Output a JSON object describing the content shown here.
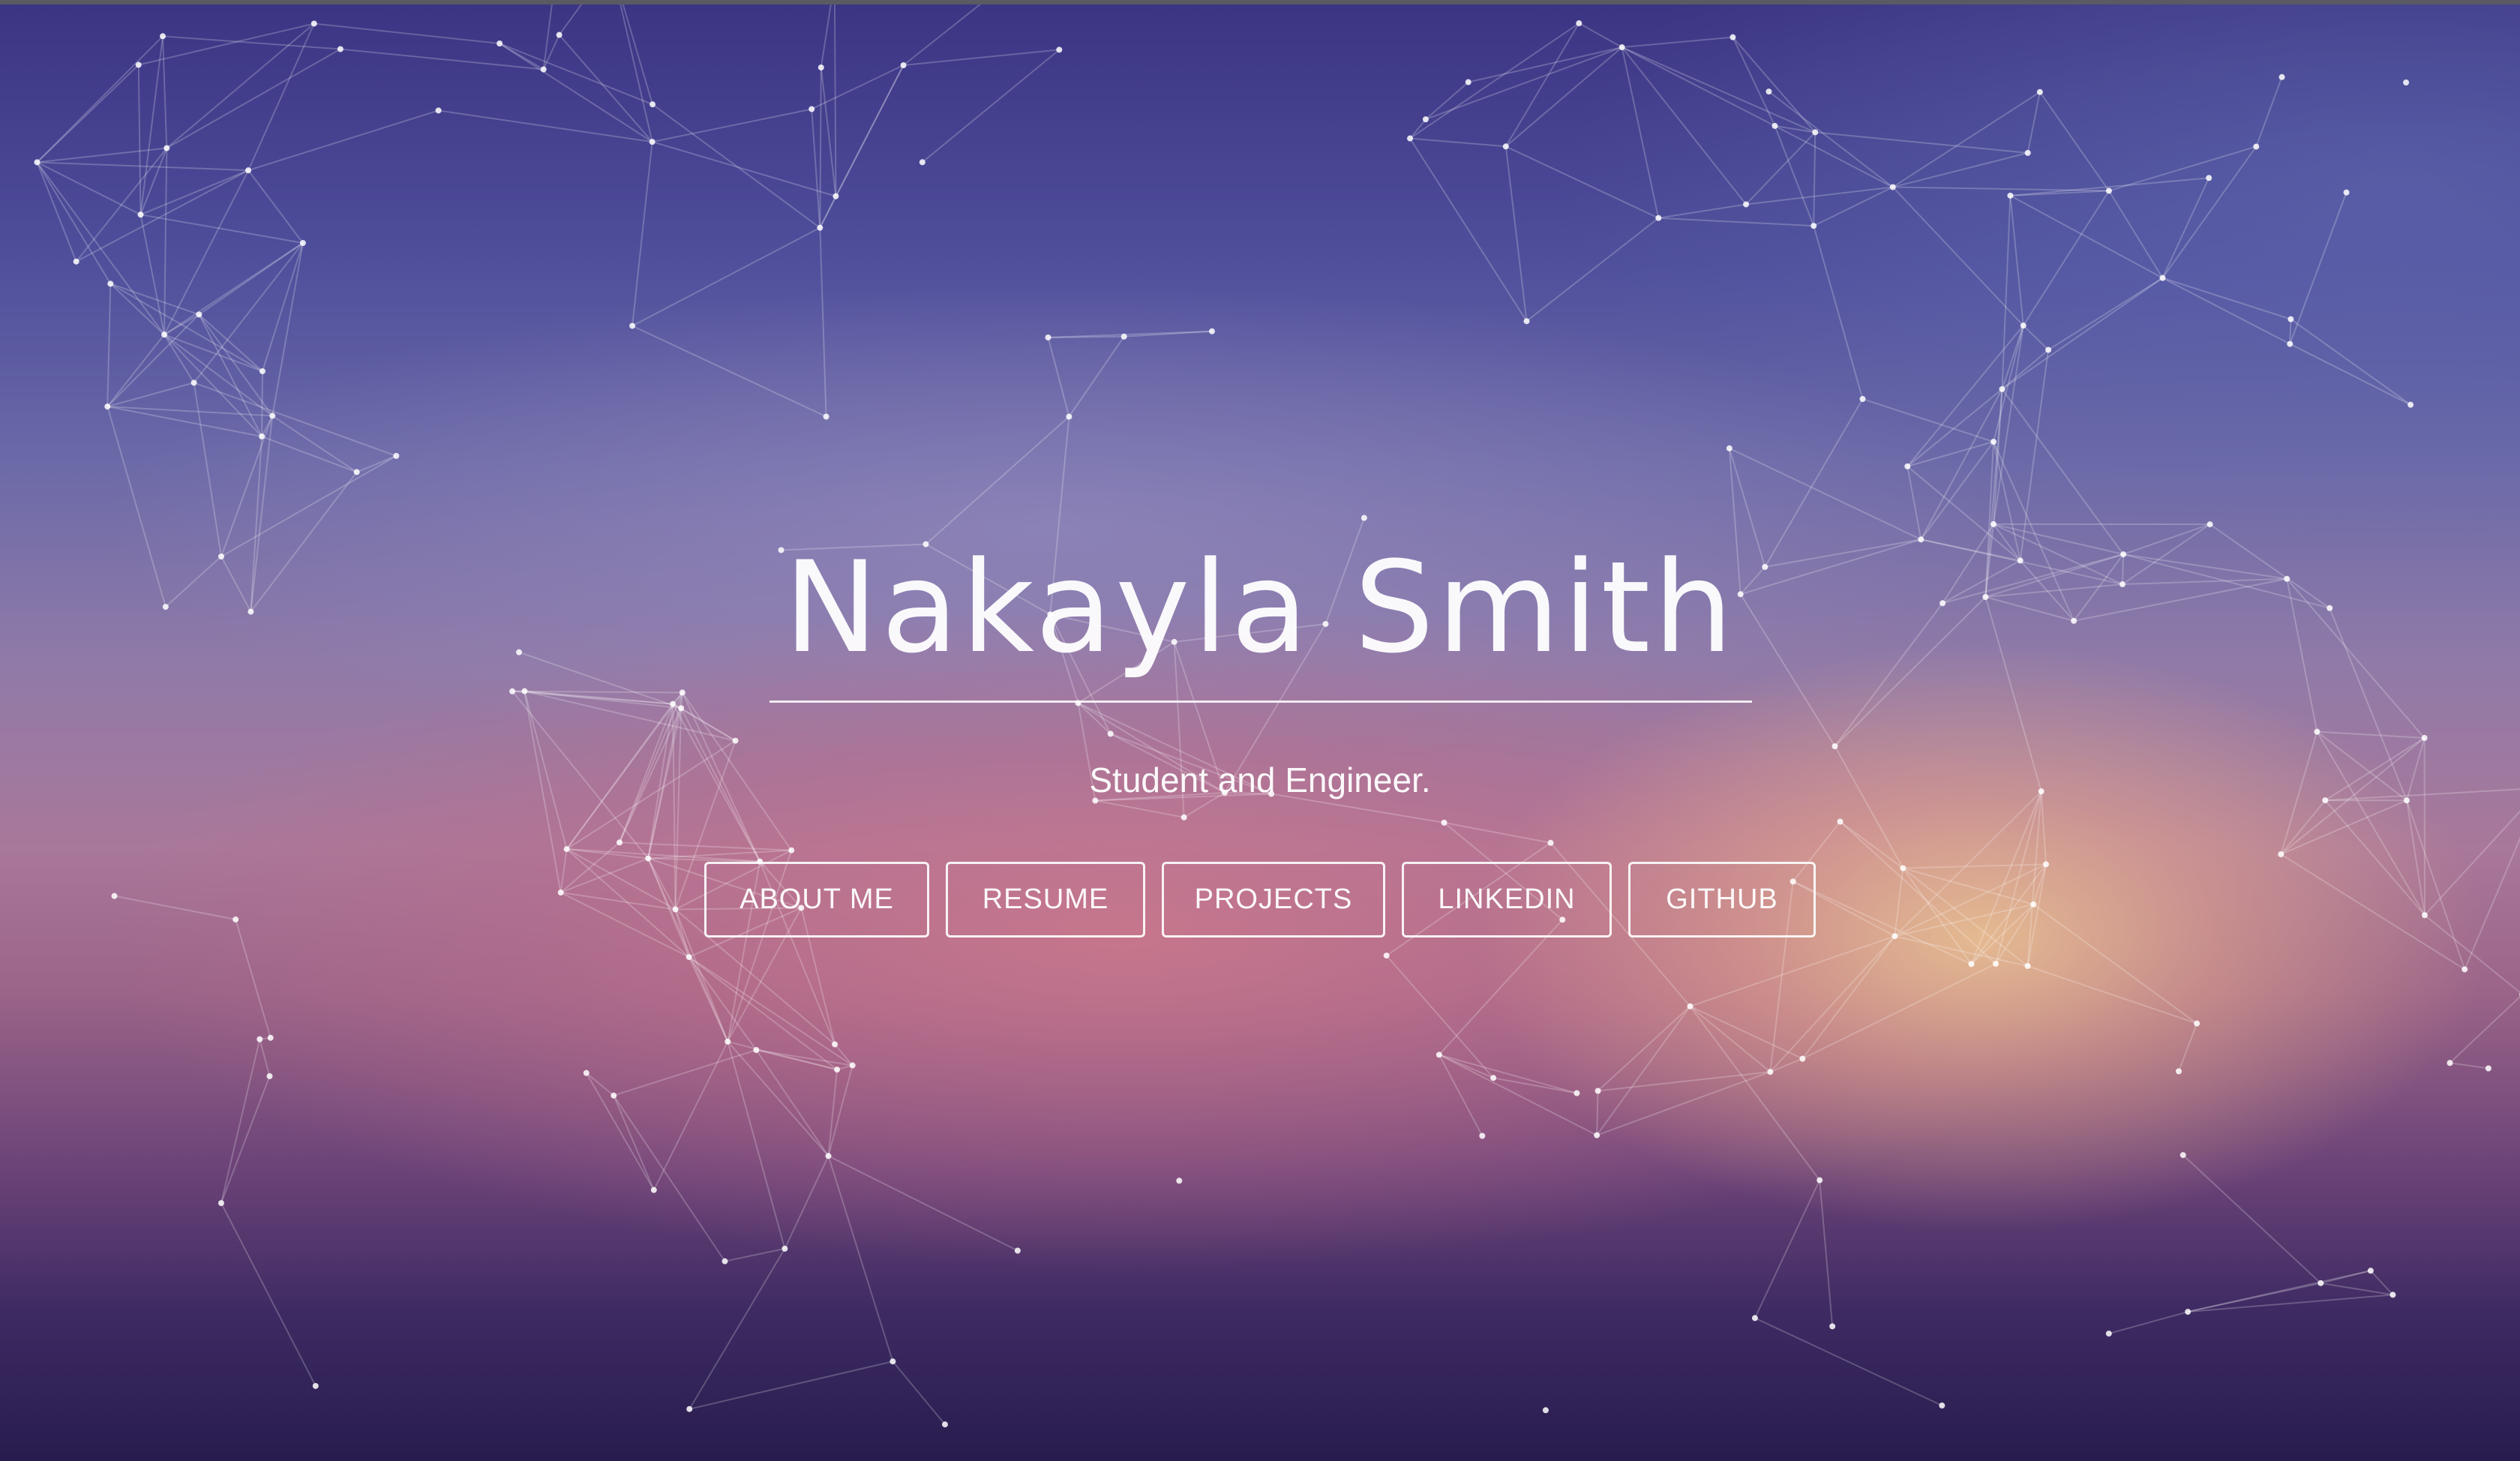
{
  "hero": {
    "name": "Nakayla Smith",
    "tagline": "Student and Engineer."
  },
  "nav": {
    "about_label": "ABOUT ME",
    "resume_label": "RESUME",
    "projects_label": "PROJECTS",
    "linkedin_label": "LINKEDIN",
    "github_label": "GITHUB"
  },
  "colors": {
    "text": "#ffffff",
    "top_purple": "#3b3483",
    "bottom_purple": "#281c4e",
    "glow_peach": "#e8be91",
    "glow_pink": "#cd788c"
  }
}
